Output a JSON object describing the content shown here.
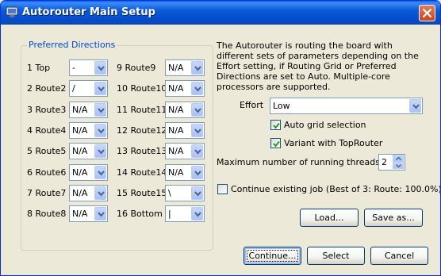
{
  "window": {
    "title": "Autorouter Main Setup"
  },
  "preferred_directions": {
    "legend": "Preferred Directions",
    "left_rows": [
      {
        "label": "1  Top",
        "value": "-"
      },
      {
        "label": "2  Route2",
        "value": "/"
      },
      {
        "label": "3  Route3",
        "value": "N/A"
      },
      {
        "label": "4  Route4",
        "value": "N/A"
      },
      {
        "label": "5  Route5",
        "value": "N/A"
      },
      {
        "label": "6  Route6",
        "value": "N/A"
      },
      {
        "label": "7  Route7",
        "value": "N/A"
      },
      {
        "label": "8  Route8",
        "value": "N/A"
      }
    ],
    "right_rows": [
      {
        "label": "9  Route9",
        "value": "N/A"
      },
      {
        "label": "10  Route10",
        "value": "N/A"
      },
      {
        "label": "11  Route11",
        "value": "N/A"
      },
      {
        "label": "12  Route12",
        "value": "N/A"
      },
      {
        "label": "13  Route13",
        "value": "N/A"
      },
      {
        "label": "14  Route14",
        "value": "N/A"
      },
      {
        "label": "15  Route15",
        "value": "\\"
      },
      {
        "label": "16  Bottom",
        "value": "|"
      }
    ]
  },
  "description": [
    "The Autorouter is routing the board with",
    "different sets of parameters depending on the",
    "Effort setting, if Routing Grid or Preferred",
    "Directions are set to Auto. Multiple-core",
    "processors are supported."
  ],
  "effort": {
    "label": "Effort",
    "value": "Low"
  },
  "auto_grid": {
    "label": "Auto grid selection",
    "checked": true
  },
  "variant": {
    "label": "Variant with TopRouter",
    "checked": true
  },
  "threads": {
    "label": "Maximum number of running threads",
    "value": "2"
  },
  "continue_job": {
    "label": "Continue existing job (Best of 3: Route: 100.0%)",
    "checked": false
  },
  "buttons": {
    "load": "Load...",
    "save_as": "Save as...",
    "continue": "Continue...",
    "select": "Select",
    "cancel": "Cancel"
  },
  "colors": {
    "titlebar": "#0a5bd8",
    "group_legend": "#0046d5",
    "check_mark": "#21a121"
  }
}
